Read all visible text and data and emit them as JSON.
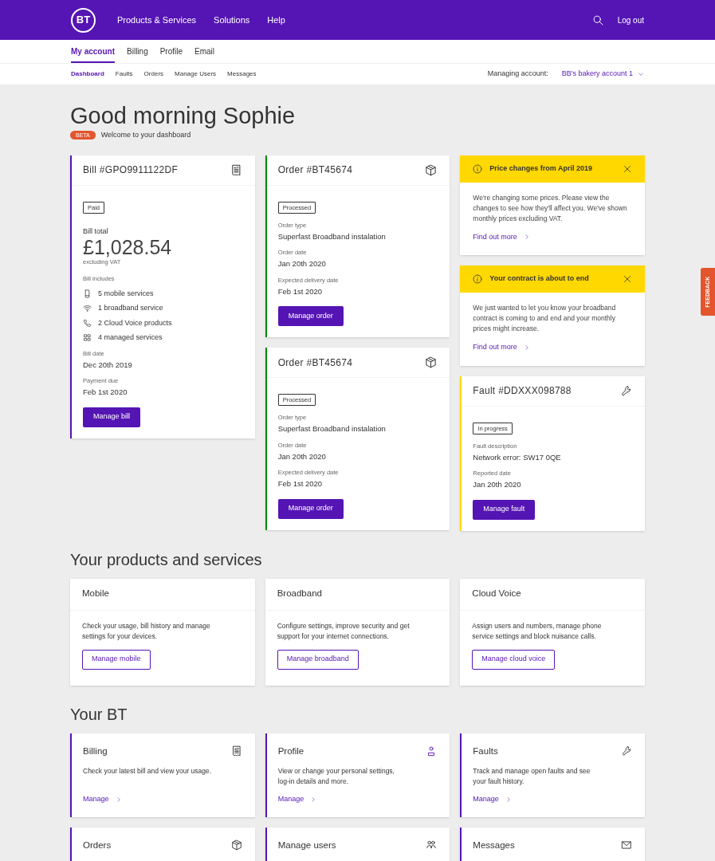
{
  "header": {
    "logo": "BT",
    "nav": [
      {
        "label": "Products & Services"
      },
      {
        "label": "Solutions"
      },
      {
        "label": "Help"
      }
    ],
    "logout": "Log out"
  },
  "account_tabs": [
    {
      "label": "My account",
      "selected": true
    },
    {
      "label": "Billing",
      "selected": false
    },
    {
      "label": "Profile",
      "selected": false
    },
    {
      "label": "Email",
      "selected": false
    }
  ],
  "sub_tabs": [
    {
      "label": "Dashboard",
      "selected": true
    },
    {
      "label": "Faults",
      "selected": false
    },
    {
      "label": "Orders",
      "selected": false
    },
    {
      "label": "Manage Users",
      "selected": false
    },
    {
      "label": "Messages",
      "selected": false
    }
  ],
  "managing_account": {
    "label": "Managing account:",
    "value": "BB's bakery account 1"
  },
  "greeting": "Good morning Sophie",
  "badge": "BETA",
  "welcome": "Welcome to your dashboard",
  "dashboard": {
    "columns": [
      {
        "cards": [
          {
            "kind": "bill",
            "title": "Bill #GPO9911122DF",
            "status": "Paid",
            "total_label": "Bill total",
            "total": "£1,028.54",
            "total_note": "excluding VAT",
            "includes_label": "Bill includes",
            "includes": [
              {
                "kind": "mobile",
                "text": "5 mobile services"
              },
              {
                "kind": "wifi",
                "text": "1 broadband service"
              },
              {
                "kind": "phone",
                "text": "2 Cloud Voice products"
              },
              {
                "kind": "grid",
                "text": "4 managed services"
              }
            ],
            "fields": [
              {
                "label": "Bill date",
                "value": "Dec 20th 2019"
              },
              {
                "label": "Payment due",
                "value": "Feb 1st 2020"
              }
            ],
            "button": "Manage bill"
          }
        ]
      },
      {
        "cards": [
          {
            "kind": "order",
            "title": "Order #BT45674",
            "status": "Processed",
            "fields": [
              {
                "label": "Order type",
                "value": "Superfast Broadband instalation"
              },
              {
                "label": "Order date",
                "value": "Jan 20th 2020"
              },
              {
                "label": "Expected delivery date",
                "value": "Feb 1st 2020"
              }
            ],
            "button": "Manage order"
          },
          {
            "kind": "order",
            "title": "Order #BT45674",
            "status": "Processed",
            "fields": [
              {
                "label": "Order type",
                "value": "Superfast Broadband instalation"
              },
              {
                "label": "Order date",
                "value": "Jan 20th 2020"
              },
              {
                "label": "Expected delivery date",
                "value": "Feb 1st 2020"
              }
            ],
            "button": "Manage order"
          }
        ]
      },
      {
        "cards": [
          {
            "kind": "notice",
            "title": "Price changes from April 2019",
            "body": "We're changing some prices. Please view the changes to see how they'll affect you. We've shown monthly prices excluding VAT.",
            "link": "Find out more"
          },
          {
            "kind": "notice",
            "title": "Your contract is about to end",
            "body": "We just wanted to let you know your broadband contract is coming to and end and your monthly prices might increase.",
            "link": "Find out more"
          },
          {
            "kind": "fault",
            "title": "Fault #DDXXX098788",
            "status": "In progress",
            "fields": [
              {
                "label": "Fault description",
                "value": "Network error: SW17 0QE"
              },
              {
                "label": "Reported date",
                "value": "Jan 20th 2020"
              }
            ],
            "button": "Manage fault"
          }
        ]
      }
    ]
  },
  "products": {
    "heading": "Your products and services",
    "items": [
      {
        "title": "Mobile",
        "description": "Check your usage, bill history and manage settings for your devices.",
        "button": "Manage mobile"
      },
      {
        "title": "Broadband",
        "description": "Configure settings, improve security and get support for your internet connections.",
        "button": "Manage broadband"
      },
      {
        "title": "Cloud Voice",
        "description": "Assign users and numbers, manage phone service settings and block nuisance calls.",
        "button": "Manage cloud voice"
      }
    ]
  },
  "your_bt": {
    "heading": "Your BT",
    "items": [
      {
        "kind": "bill",
        "title": "Billing",
        "description": "Check your latest bill and view your usage.",
        "link": "Manage"
      },
      {
        "kind": "profile",
        "title": "Profile",
        "description": "View or change your personal settings, log-in details and more.",
        "link": "Manage"
      },
      {
        "kind": "fault",
        "title": "Faults",
        "description": "Track and manage open faults and see your fault history.",
        "link": "Manage"
      },
      {
        "kind": "order",
        "title": "Orders"
      },
      {
        "kind": "users",
        "title": "Manage users"
      },
      {
        "kind": "messages",
        "title": "Messages"
      }
    ]
  },
  "feedback": "FEEDBACK"
}
